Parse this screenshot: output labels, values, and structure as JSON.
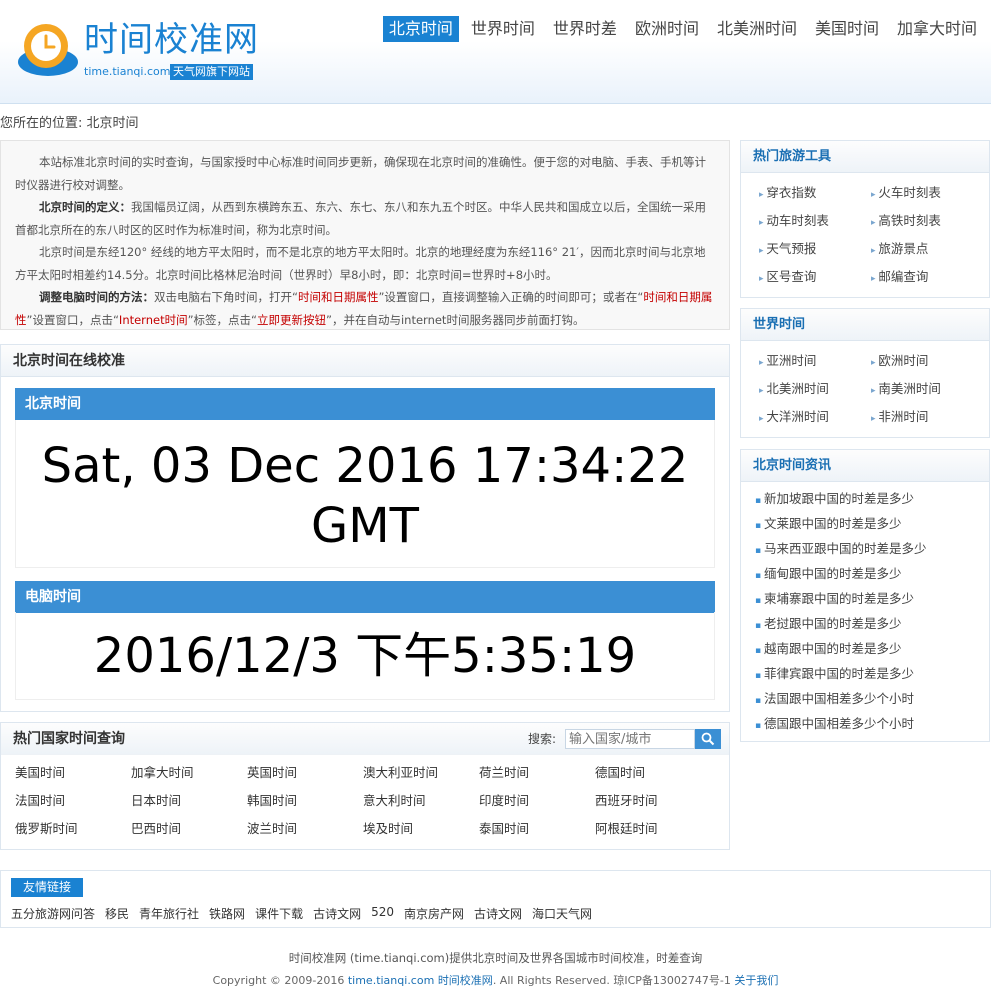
{
  "brand": {
    "title": "时间校准网",
    "url": "time.tianqi.com",
    "badge": "天气网旗下网站"
  },
  "nav": [
    "北京时间",
    "世界时间",
    "世界时差",
    "欧洲时间",
    "北美洲时间",
    "美国时间",
    "加拿大时间"
  ],
  "breadcrumb": "您所在的位置: 北京时间",
  "intro": {
    "p1": "本站标准北京时间的实时查询，与国家授时中心标准时间同步更新，确保现在北京时间的准确性。便于您的对电脑、手表、手机等计时仪器进行校对调整。",
    "p2_label": "北京时间的定义：",
    "p2": "我国幅员辽阔，从西到东横跨东五、东六、东七、东八和东九五个时区。中华人民共和国成立以后，全国统一采用首都北京所在的东八时区的区时作为标准时间，称为北京时间。",
    "p3": "北京时间是东经120° 经线的地方平太阳时，而不是北京的地方平太阳时。北京的地理经度为东经116° 21′，因而北京时间与北京地方平太阳时相差约14.5分。北京时间比格林尼治时间（世界时）早8小时，即：北京时间=世界时+8小时。",
    "p4_label": "调整电脑时间的方法：",
    "p4_a": "双击电脑右下角时间，打开“",
    "p4_red1": "时间和日期属性",
    "p4_b": "”设置窗口，直接调整输入正确的时间即可；或者在“",
    "p4_red2": "时间和日期属性",
    "p4_c": "”设置窗口，点击“",
    "p4_red3": "Internet时间",
    "p4_d": "”标签，点击“",
    "p4_red4": "立即更新按钮",
    "p4_e": "”，并在自动与internet时间服务器同步前面打钩。"
  },
  "calibration": {
    "title": "北京时间在线校准",
    "beijing_label": "北京时间",
    "beijing_time": "Sat, 03 Dec 2016 17:34:22 GMT",
    "computer_label": "电脑时间",
    "computer_time": "2016/12/3 下午5:35:19"
  },
  "countries": {
    "title": "热门国家时间查询",
    "search_label": "搜索:",
    "search_placeholder": "输入国家/城市",
    "items": [
      "美国时间",
      "加拿大时间",
      "英国时间",
      "澳大利亚时间",
      "荷兰时间",
      "德国时间",
      "法国时间",
      "日本时间",
      "韩国时间",
      "意大利时间",
      "印度时间",
      "西班牙时间",
      "俄罗斯时间",
      "巴西时间",
      "波兰时间",
      "埃及时间",
      "泰国时间",
      "阿根廷时间"
    ]
  },
  "sidebar": {
    "tools_title": "热门旅游工具",
    "tools": [
      "穿衣指数",
      "火车时刻表",
      "动车时刻表",
      "高铁时刻表",
      "天气预报",
      "旅游景点",
      "区号查询",
      "邮编查询"
    ],
    "world_title": "世界时间",
    "world": [
      "亚洲时间",
      "欧洲时间",
      "北美洲时间",
      "南美洲时间",
      "大洋洲时间",
      "非洲时间"
    ],
    "news_title": "北京时间资讯",
    "news": [
      "新加坡跟中国的时差是多少",
      "文莱跟中国的时差是多少",
      "马来西亚跟中国的时差是多少",
      "缅甸跟中国的时差是多少",
      "柬埔寨跟中国的时差是多少",
      "老挝跟中国的时差是多少",
      "越南跟中国的时差是多少",
      "菲律宾跟中国的时差是多少",
      "法国跟中国相差多少个小时",
      "德国跟中国相差多少个小时"
    ]
  },
  "friend_links": {
    "title": "友情链接",
    "items": [
      "五分旅游网问答",
      "移民",
      "青年旅行社",
      "铁路网",
      "课件下载",
      "古诗文网",
      "520",
      "南京房产网",
      "古诗文网",
      "海口天气网"
    ]
  },
  "footer": {
    "line1": "时间校准网 (time.tianqi.com)提供北京时间及世界各国城市时间校准，时差查询",
    "copyright": "Copyright © 2009-2016",
    "site_url": "time.tianqi.com",
    "site_name": "时间校准网",
    "rights": ". All Rights Reserved. 琼ICP备13002747号-1",
    "about": "关于我们"
  },
  "colors": {
    "brand_blue": "#1a82d2",
    "bar_blue": "#3b8fd4",
    "highlight_red": "#c40000"
  }
}
